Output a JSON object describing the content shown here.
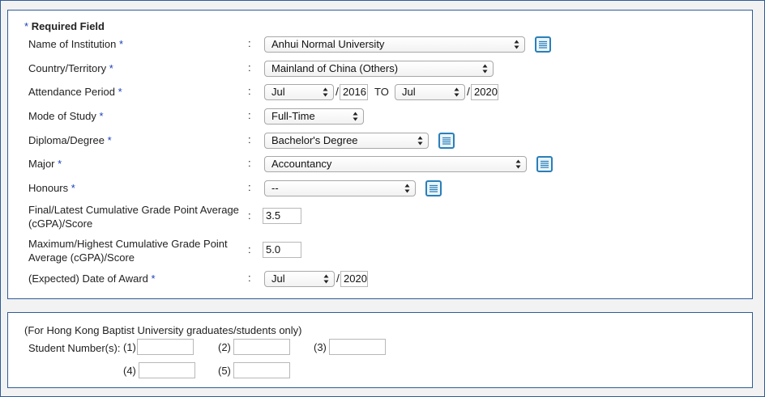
{
  "required_note": {
    "star": "*",
    "text": "Required Field"
  },
  "colon": ":",
  "star": "*",
  "fields": {
    "institution": {
      "label": "Name of Institution",
      "value": "Anhui Normal University"
    },
    "country": {
      "label": "Country/Territory",
      "value": "Mainland of China (Others)"
    },
    "attendance": {
      "label": "Attendance Period",
      "from_month": "Jul",
      "from_year": "2016",
      "to_text": "TO",
      "to_month": "Jul",
      "to_year": "2020"
    },
    "mode": {
      "label": "Mode of Study",
      "value": "Full-Time"
    },
    "diploma": {
      "label": "Diploma/Degree",
      "value": "Bachelor's Degree"
    },
    "major": {
      "label": "Major",
      "value": "Accountancy"
    },
    "honours": {
      "label": "Honours",
      "value": "--"
    },
    "final_cgpa": {
      "label": "Final/Latest Cumulative Grade Point Average (cGPA)/Score",
      "value": "3.5"
    },
    "max_cgpa": {
      "label": "Maximum/Highest Cumulative Grade Point Average (cGPA)/Score",
      "value": "5.0"
    },
    "award_date": {
      "label": "(Expected) Date of Award",
      "month": "Jul",
      "year": "2020"
    }
  },
  "hkbu": {
    "note": "(For Hong Kong Baptist University graduates/students only)",
    "student_label": "Student Number(s):",
    "numbers": [
      {
        "label": "(1)",
        "value": ""
      },
      {
        "label": "(2)",
        "value": ""
      },
      {
        "label": "(3)",
        "value": ""
      },
      {
        "label": "(4)",
        "value": ""
      },
      {
        "label": "(5)",
        "value": ""
      }
    ]
  },
  "icons": {
    "list_button": "list-icon",
    "select_arrows": "up-down-arrows-icon"
  },
  "colors": {
    "accent_border": "#2d5c9a",
    "required_star": "#1b3fb8",
    "list_icon": "#2a7fb8"
  }
}
